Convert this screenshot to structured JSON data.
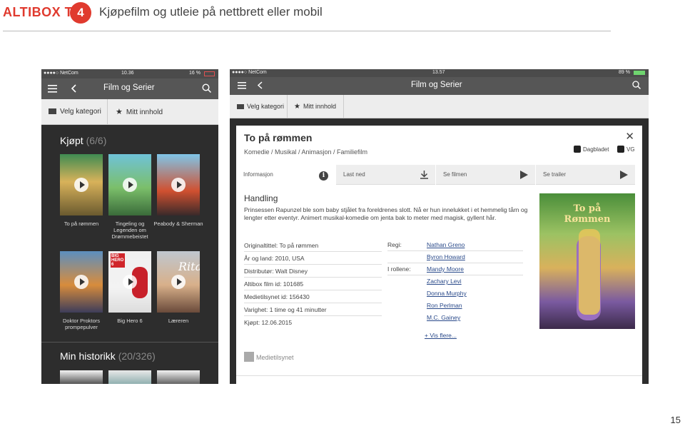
{
  "slide": {
    "brand": "ALTIBOX TV",
    "badge": "4",
    "title": "Kjøpefilm og utleie på nettbrett eller mobil",
    "page_number": "15"
  },
  "phone": {
    "status": {
      "carrier": "●●●●○ NetCom",
      "time": "10.36",
      "battery": "16 %"
    },
    "nav_title": "Film og Serier",
    "tabs": [
      "Velg kategori",
      "Mitt innhold"
    ],
    "section1": {
      "title": "Kjøpt",
      "count": "(6/6)"
    },
    "movies": [
      {
        "caption": "To på rømmen"
      },
      {
        "caption": "Tingeling og Legenden om Drømmebeistet"
      },
      {
        "caption": "Peabody & Sherman"
      },
      {
        "caption": "Doktor Proktors prompepulver"
      },
      {
        "caption": "Big Hero 6"
      },
      {
        "caption": "Læreren"
      }
    ],
    "poster_texts": {
      "big_hero": "BIG HERO 6",
      "rita": "Rita"
    },
    "section2": {
      "title": "Min historikk",
      "count": "(20/326)"
    }
  },
  "tablet": {
    "status": {
      "carrier": "●●●●○ NetCom",
      "time": "13.57",
      "battery": "89 %"
    },
    "nav_title": "Film og Serier",
    "tabs": [
      "Velg kategori",
      "Mitt innhold"
    ],
    "modal": {
      "title": "To på rømmen",
      "genres": "Komedie / Musikal / Animasjon / Familiefilm",
      "ratings": [
        "Dagbladet",
        "VG"
      ],
      "tabs": [
        {
          "label": "Informasjon"
        },
        {
          "label": "Last ned"
        },
        {
          "label": "Se filmen"
        },
        {
          "label": "Se trailer"
        }
      ],
      "section_heading": "Handling",
      "description": "Prinsessen Rapunzel ble som baby stjålet fra foreldrenes slott. Nå er hun innelukket i et hemmelig tårn og lengter etter eventyr. Animert musikal-komedie om jenta bak to meter med magisk, gyllent hår.",
      "details": [
        "Originaltittel: To på rømmen",
        "År og land: 2010, USA",
        "Distributør: Walt Disney",
        "Altibox film id: 101685",
        "Medietilsynet id: 156430",
        "Varighet: 1 time og 41 minutter",
        "Kjøpt: 12.06.2015"
      ],
      "credits": [
        {
          "label": "Regi:",
          "name": "Nathan Greno"
        },
        {
          "label": "",
          "name": "Byron Howard"
        },
        {
          "label": "I rollene:",
          "name": "Mandy Moore"
        },
        {
          "label": "",
          "name": "Zachary Levi"
        },
        {
          "label": "",
          "name": "Donna Murphy"
        },
        {
          "label": "",
          "name": "Ron Perlman"
        },
        {
          "label": "",
          "name": "M.C. Gainey"
        }
      ],
      "more_link": "+ Vis flere...",
      "footer_logo": "Medietilsynet",
      "poster_title": "To på Rømmen"
    }
  }
}
